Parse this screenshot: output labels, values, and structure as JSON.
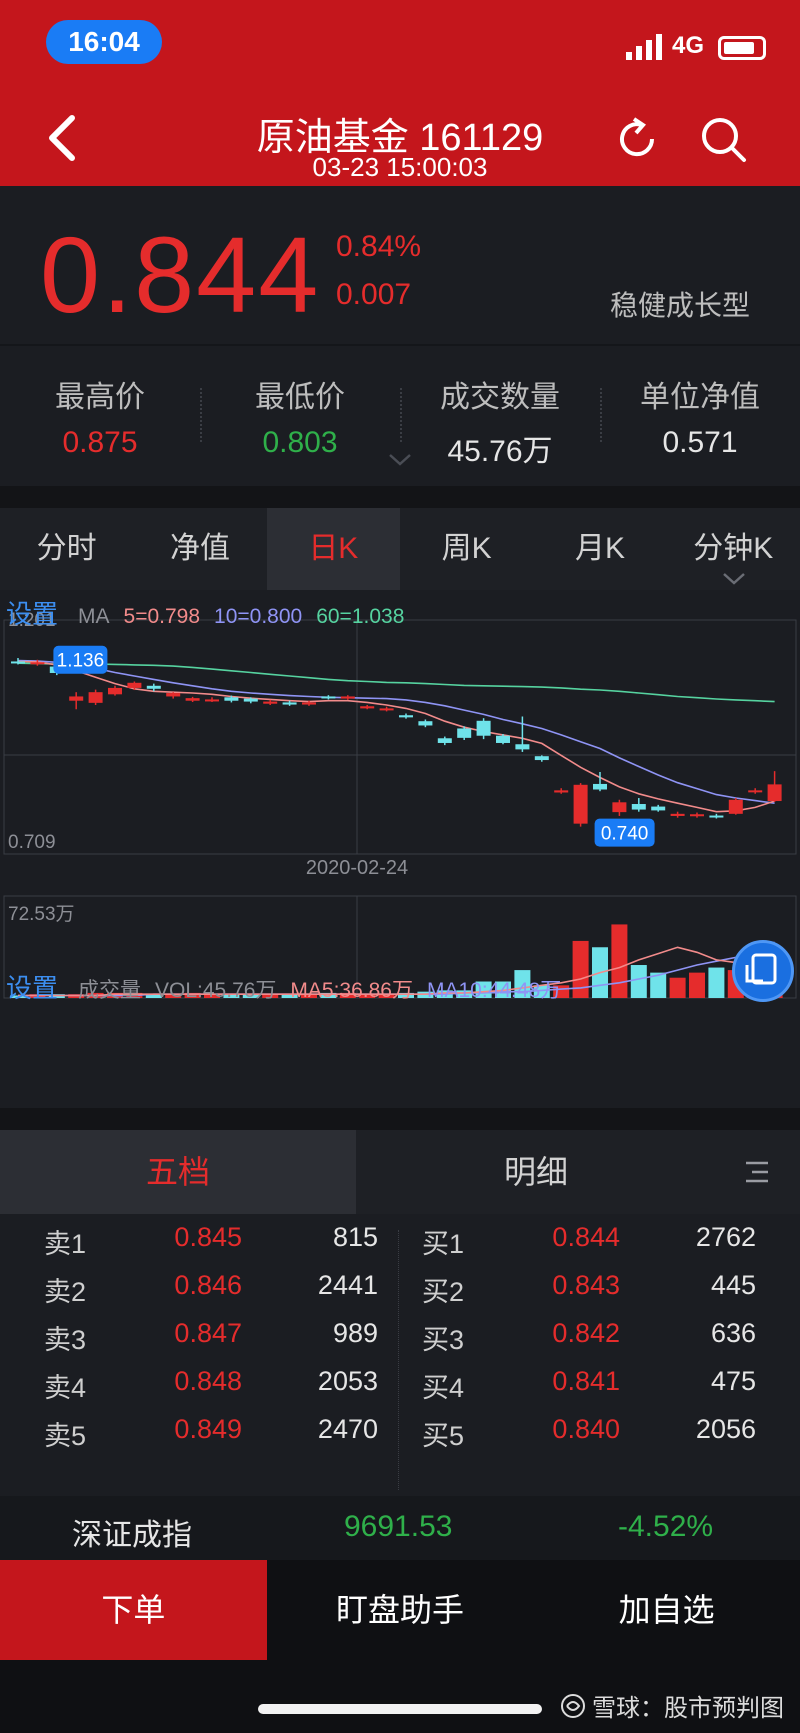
{
  "status_bar": {
    "time": "16:04",
    "network": "4G"
  },
  "header": {
    "title": "原油基金 161129",
    "subtitle": "03-23 15:00:03"
  },
  "quote": {
    "price": "0.844",
    "change_pct": "0.84%",
    "change": "0.007",
    "fund_type": "稳健成长型"
  },
  "stats": [
    {
      "label": "最高价",
      "value": "0.875",
      "color": "#e52c2c"
    },
    {
      "label": "最低价",
      "value": "0.803",
      "color": "#2fb04a"
    },
    {
      "label": "成交数量",
      "value": "45.76万",
      "color": "#e6e6e6"
    },
    {
      "label": "单位净值",
      "value": "0.571",
      "color": "#e6e6e6"
    }
  ],
  "tabs": [
    "分时",
    "净值",
    "日K",
    "周K",
    "月K",
    "分钟K"
  ],
  "active_tab": "日K",
  "chart_legend": {
    "settings": "设置",
    "ma_label": "MA",
    "ma5": "5=0.798",
    "ma10": "10=0.800",
    "ma60": "60=1.038"
  },
  "volume_legend": {
    "settings": "设置",
    "label": "成交量",
    "vol": "VOL:45.76万",
    "ma5": "MA5:36.86万",
    "ma10": "MA10:44.48万"
  },
  "chart_data": {
    "type": "candlestick",
    "price_axis": {
      "max_label": "1.201",
      "min_label": "0.709",
      "ylim": [
        0.709,
        1.201
      ]
    },
    "date_label": "2020-02-24",
    "high_marker": "1.136",
    "low_marker": "0.740",
    "volume_max_label": "72.53万",
    "colors": {
      "up": "#e52c2c",
      "down": "#6fe3ea",
      "ma5": "#f28b8b",
      "ma10": "#8f94f5",
      "ma60": "#56d3a0"
    },
    "candles": [
      {
        "o": 1.132,
        "c": 1.128,
        "h": 1.14,
        "l": 1.125,
        "v": 2
      },
      {
        "o": 1.128,
        "c": 1.13,
        "h": 1.136,
        "l": 1.122,
        "v": 3
      },
      {
        "o": 1.12,
        "c": 1.105,
        "h": 1.123,
        "l": 1.1,
        "v": 3
      },
      {
        "o": 1.04,
        "c": 1.05,
        "h": 1.06,
        "l": 1.02,
        "v": 3
      },
      {
        "o": 1.035,
        "c": 1.06,
        "h": 1.066,
        "l": 1.03,
        "v": 4
      },
      {
        "o": 1.055,
        "c": 1.07,
        "h": 1.075,
        "l": 1.052,
        "v": 4
      },
      {
        "o": 1.07,
        "c": 1.082,
        "h": 1.085,
        "l": 1.065,
        "v": 4
      },
      {
        "o": 1.075,
        "c": 1.068,
        "h": 1.08,
        "l": 1.062,
        "v": 3
      },
      {
        "o": 1.05,
        "c": 1.058,
        "h": 1.06,
        "l": 1.045,
        "v": 3
      },
      {
        "o": 1.04,
        "c": 1.046,
        "h": 1.049,
        "l": 1.037,
        "v": 4
      },
      {
        "o": 1.04,
        "c": 1.043,
        "h": 1.048,
        "l": 1.037,
        "v": 3
      },
      {
        "o": 1.048,
        "c": 1.04,
        "h": 1.052,
        "l": 1.036,
        "v": 3
      },
      {
        "o": 1.045,
        "c": 1.038,
        "h": 1.048,
        "l": 1.034,
        "v": 3
      },
      {
        "o": 1.033,
        "c": 1.038,
        "h": 1.042,
        "l": 1.03,
        "v": 3
      },
      {
        "o": 1.036,
        "c": 1.031,
        "h": 1.04,
        "l": 1.028,
        "v": 3
      },
      {
        "o": 1.031,
        "c": 1.036,
        "h": 1.04,
        "l": 1.028,
        "v": 3
      },
      {
        "o": 1.05,
        "c": 1.046,
        "h": 1.053,
        "l": 1.043,
        "v": 4
      },
      {
        "o": 1.045,
        "c": 1.05,
        "h": 1.053,
        "l": 1.042,
        "v": 4
      },
      {
        "o": 1.022,
        "c": 1.027,
        "h": 1.03,
        "l": 1.02,
        "v": 3
      },
      {
        "o": 1.018,
        "c": 1.022,
        "h": 1.026,
        "l": 1.015,
        "v": 3
      },
      {
        "o": 1.006,
        "c": 1.001,
        "h": 1.01,
        "l": 0.998,
        "v": 4
      },
      {
        "o": 0.992,
        "c": 0.982,
        "h": 0.996,
        "l": 0.978,
        "v": 5
      },
      {
        "o": 0.952,
        "c": 0.941,
        "h": 0.956,
        "l": 0.936,
        "v": 6
      },
      {
        "o": 0.975,
        "c": 0.953,
        "h": 0.98,
        "l": 0.948,
        "v": 6
      },
      {
        "o": 0.993,
        "c": 0.958,
        "h": 0.999,
        "l": 0.95,
        "v": 13
      },
      {
        "o": 0.958,
        "c": 0.941,
        "h": 0.962,
        "l": 0.938,
        "v": 13
      },
      {
        "o": 0.938,
        "c": 0.926,
        "h": 1.003,
        "l": 0.92,
        "v": 22
      },
      {
        "o": 0.91,
        "c": 0.901,
        "h": 0.912,
        "l": 0.897,
        "v": 10
      },
      {
        "o": 0.825,
        "c": 0.83,
        "h": 0.835,
        "l": 0.822,
        "v": 10
      },
      {
        "o": 0.752,
        "c": 0.843,
        "h": 0.847,
        "l": 0.745,
        "v": 45
      },
      {
        "o": 0.845,
        "c": 0.832,
        "h": 0.873,
        "l": 0.828,
        "v": 40
      },
      {
        "o": 0.779,
        "c": 0.802,
        "h": 0.808,
        "l": 0.77,
        "v": 58
      },
      {
        "o": 0.798,
        "c": 0.785,
        "h": 0.812,
        "l": 0.78,
        "v": 26
      },
      {
        "o": 0.792,
        "c": 0.783,
        "h": 0.796,
        "l": 0.78,
        "v": 20
      },
      {
        "o": 0.77,
        "c": 0.775,
        "h": 0.78,
        "l": 0.766,
        "v": 16
      },
      {
        "o": 0.77,
        "c": 0.774,
        "h": 0.778,
        "l": 0.766,
        "v": 20
      },
      {
        "o": 0.771,
        "c": 0.767,
        "h": 0.775,
        "l": 0.764,
        "v": 24
      },
      {
        "o": 0.775,
        "c": 0.808,
        "h": 0.812,
        "l": 0.773,
        "v": 22
      },
      {
        "o": 0.826,
        "c": 0.83,
        "h": 0.835,
        "l": 0.822,
        "v": 40
      },
      {
        "o": 0.805,
        "c": 0.844,
        "h": 0.875,
        "l": 0.803,
        "v": 32
      }
    ],
    "ma5": [
      1.132,
      1.131,
      1.124,
      1.11,
      1.095,
      1.08,
      1.068,
      1.062,
      1.06,
      1.058,
      1.055,
      1.05,
      1.046,
      1.043,
      1.04,
      1.038,
      1.04,
      1.04,
      1.036,
      1.03,
      1.022,
      1.01,
      0.992,
      0.978,
      0.968,
      0.96,
      0.952,
      0.94,
      0.912,
      0.884,
      0.86,
      0.838,
      0.822,
      0.81,
      0.8,
      0.79,
      0.78,
      0.782,
      0.79,
      0.805
    ],
    "ma10": [
      1.134,
      1.133,
      1.13,
      1.124,
      1.116,
      1.106,
      1.098,
      1.09,
      1.082,
      1.075,
      1.068,
      1.062,
      1.058,
      1.055,
      1.052,
      1.05,
      1.048,
      1.047,
      1.046,
      1.045,
      1.042,
      1.036,
      1.028,
      1.018,
      1.008,
      0.996,
      0.986,
      0.975,
      0.96,
      0.944,
      0.928,
      0.906,
      0.886,
      0.866,
      0.848,
      0.834,
      0.82,
      0.812,
      0.806,
      0.8
    ],
    "ma60": [
      1.128,
      1.127,
      1.126,
      1.126,
      1.126,
      1.125,
      1.124,
      1.123,
      1.121,
      1.118,
      1.114,
      1.11,
      1.106,
      1.102,
      1.098,
      1.094,
      1.09,
      1.087,
      1.085,
      1.083,
      1.082,
      1.08,
      1.078,
      1.076,
      1.075,
      1.074,
      1.073,
      1.072,
      1.07,
      1.067,
      1.065,
      1.062,
      1.058,
      1.054,
      1.05,
      1.047,
      1.044,
      1.042,
      1.04,
      1.038
    ],
    "vol_ma5": [
      2,
      2,
      2,
      2,
      2,
      3,
      3,
      3,
      3,
      3,
      3,
      3,
      3,
      3,
      3,
      3,
      3,
      3,
      3,
      3,
      3,
      3,
      4,
      4,
      5,
      6,
      8,
      10,
      12,
      15,
      20,
      24,
      30,
      35,
      40,
      36,
      30,
      28,
      34,
      36
    ],
    "vol_ma10": [
      2,
      2,
      2,
      2,
      2,
      2,
      2,
      3,
      3,
      3,
      3,
      3,
      3,
      3,
      3,
      3,
      3,
      3,
      3,
      3,
      3,
      3,
      3,
      4,
      4,
      5,
      5,
      6,
      7,
      8,
      10,
      12,
      15,
      18,
      22,
      26,
      29,
      32,
      38,
      44
    ]
  },
  "orderbook_tabs": [
    "五档",
    "明细"
  ],
  "orderbook": {
    "asks": [
      {
        "label": "卖1",
        "price": "0.845",
        "volume": "815"
      },
      {
        "label": "卖2",
        "price": "0.846",
        "volume": "2441"
      },
      {
        "label": "卖3",
        "price": "0.847",
        "volume": "989"
      },
      {
        "label": "卖4",
        "price": "0.848",
        "volume": "2053"
      },
      {
        "label": "卖5",
        "price": "0.849",
        "volume": "2470"
      }
    ],
    "bids": [
      {
        "label": "买1",
        "price": "0.844",
        "volume": "2762"
      },
      {
        "label": "买2",
        "price": "0.843",
        "volume": "445"
      },
      {
        "label": "买3",
        "price": "0.842",
        "volume": "636"
      },
      {
        "label": "买4",
        "price": "0.841",
        "volume": "475"
      },
      {
        "label": "买5",
        "price": "0.840",
        "volume": "2056"
      }
    ]
  },
  "index": {
    "name": "深证成指",
    "value": "9691.53",
    "change_pct": "-4.52%"
  },
  "actions": {
    "order": "下单",
    "assistant": "盯盘助手",
    "watchlist": "加自选"
  },
  "watermark": "雪球：股市预判图"
}
